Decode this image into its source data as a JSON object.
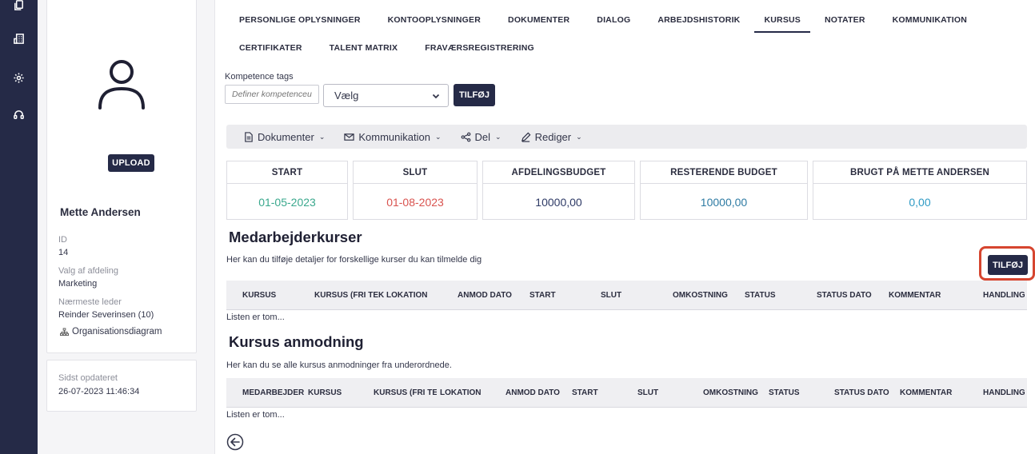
{
  "rail": {
    "icons": [
      "copy-icon",
      "building-icon",
      "gear-icon",
      "headset-icon"
    ]
  },
  "profile": {
    "upload_label": "UPLOAD",
    "name": "Mette Andersen",
    "id_label": "ID",
    "id_value": "14",
    "department_label": "Valg af afdeling",
    "department_value": "Marketing",
    "manager_label": "Nærmeste leder",
    "manager_value": "Reinder Severinsen (10)",
    "org_chart_label": "Organisationsdiagram",
    "updated_label": "Sidst opdateret",
    "updated_value": "26-07-2023 11:46:34"
  },
  "tabs": {
    "row1": [
      "PERSONLIGE OPLYSNINGER",
      "KONTOOPLYSNINGER",
      "DOKUMENTER",
      "DIALOG",
      "ARBEJDSHISTORIK",
      "KURSUS",
      "NOTATER",
      "KOMMUNIKATION"
    ],
    "row2": [
      "CERTIFIKATER",
      "TALENT MATRIX",
      "FRAVÆRSREGISTRERING"
    ],
    "active": "KURSUS"
  },
  "tags": {
    "label": "Kompetence tags",
    "placeholder": "Definer kompetenceudvikling",
    "select_value": "Vælg",
    "add_label": "TILFØJ"
  },
  "toolbar": {
    "documents": "Dokumenter",
    "communication": "Kommunikation",
    "share": "Del",
    "edit": "Rediger"
  },
  "stats": [
    {
      "label": "START",
      "value": "01-05-2023",
      "color": "#3aa88d"
    },
    {
      "label": "SLUT",
      "value": "01-08-2023",
      "color": "#d9534f"
    },
    {
      "label": "AFDELINGSBUDGET",
      "value": "10000,00",
      "color": "#2e3a66"
    },
    {
      "label": "RESTERENDE BUDGET",
      "value": "10000,00",
      "color": "#2e7ba3"
    },
    {
      "label": "BRUGT PÅ METTE ANDERSEN",
      "value": "0,00",
      "color": "#2e9ac4"
    }
  ],
  "courses": {
    "title": "Medarbejderkurser",
    "description": "Her kan du tilføje detaljer for forskellige kurser du kan tilmelde dig",
    "add_label": "TILFØJ",
    "columns": [
      "KURSUS",
      "KURSUS (FRI TEKST)",
      "LOKATION",
      "ANMOD DATO",
      "START",
      "SLUT",
      "OMKOSTNING",
      "STATUS",
      "STATUS DATO",
      "KOMMENTAR",
      "HANDLING"
    ],
    "empty": "Listen er tom..."
  },
  "requests": {
    "title": "Kursus anmodning",
    "description": "Her kan du se alle kursus anmodninger fra underordnede.",
    "columns": [
      "MEDARBEJDER NAVN",
      "KURSUS",
      "KURSUS (FRI TEKST)",
      "LOKATION",
      "ANMOD DATO",
      "START",
      "SLUT",
      "OMKOSTNING",
      "STATUS",
      "STATUS DATO",
      "KOMMENTAR",
      "HANDLING"
    ],
    "empty": "Listen er tom..."
  }
}
